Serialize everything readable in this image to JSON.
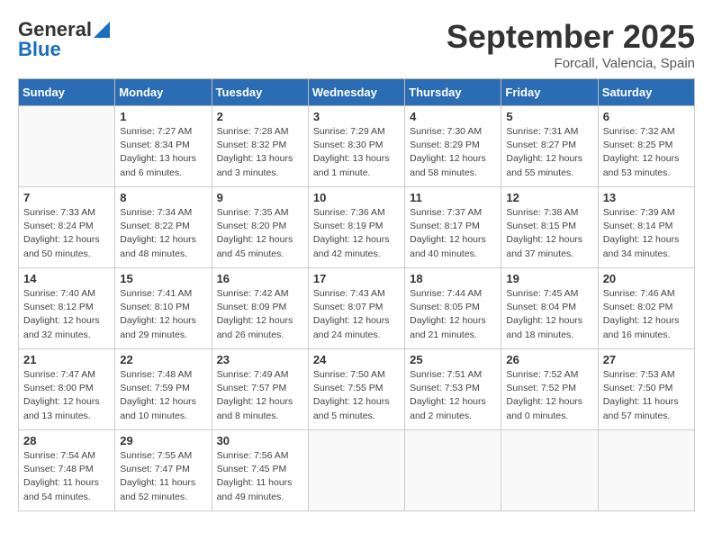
{
  "header": {
    "logo_general": "General",
    "logo_blue": "Blue",
    "month": "September 2025",
    "location": "Forcall, Valencia, Spain"
  },
  "days_of_week": [
    "Sunday",
    "Monday",
    "Tuesday",
    "Wednesday",
    "Thursday",
    "Friday",
    "Saturday"
  ],
  "weeks": [
    [
      {
        "day": "",
        "info": ""
      },
      {
        "day": "1",
        "info": "Sunrise: 7:27 AM\nSunset: 8:34 PM\nDaylight: 13 hours\nand 6 minutes."
      },
      {
        "day": "2",
        "info": "Sunrise: 7:28 AM\nSunset: 8:32 PM\nDaylight: 13 hours\nand 3 minutes."
      },
      {
        "day": "3",
        "info": "Sunrise: 7:29 AM\nSunset: 8:30 PM\nDaylight: 13 hours\nand 1 minute."
      },
      {
        "day": "4",
        "info": "Sunrise: 7:30 AM\nSunset: 8:29 PM\nDaylight: 12 hours\nand 58 minutes."
      },
      {
        "day": "5",
        "info": "Sunrise: 7:31 AM\nSunset: 8:27 PM\nDaylight: 12 hours\nand 55 minutes."
      },
      {
        "day": "6",
        "info": "Sunrise: 7:32 AM\nSunset: 8:25 PM\nDaylight: 12 hours\nand 53 minutes."
      }
    ],
    [
      {
        "day": "7",
        "info": "Sunrise: 7:33 AM\nSunset: 8:24 PM\nDaylight: 12 hours\nand 50 minutes."
      },
      {
        "day": "8",
        "info": "Sunrise: 7:34 AM\nSunset: 8:22 PM\nDaylight: 12 hours\nand 48 minutes."
      },
      {
        "day": "9",
        "info": "Sunrise: 7:35 AM\nSunset: 8:20 PM\nDaylight: 12 hours\nand 45 minutes."
      },
      {
        "day": "10",
        "info": "Sunrise: 7:36 AM\nSunset: 8:19 PM\nDaylight: 12 hours\nand 42 minutes."
      },
      {
        "day": "11",
        "info": "Sunrise: 7:37 AM\nSunset: 8:17 PM\nDaylight: 12 hours\nand 40 minutes."
      },
      {
        "day": "12",
        "info": "Sunrise: 7:38 AM\nSunset: 8:15 PM\nDaylight: 12 hours\nand 37 minutes."
      },
      {
        "day": "13",
        "info": "Sunrise: 7:39 AM\nSunset: 8:14 PM\nDaylight: 12 hours\nand 34 minutes."
      }
    ],
    [
      {
        "day": "14",
        "info": "Sunrise: 7:40 AM\nSunset: 8:12 PM\nDaylight: 12 hours\nand 32 minutes."
      },
      {
        "day": "15",
        "info": "Sunrise: 7:41 AM\nSunset: 8:10 PM\nDaylight: 12 hours\nand 29 minutes."
      },
      {
        "day": "16",
        "info": "Sunrise: 7:42 AM\nSunset: 8:09 PM\nDaylight: 12 hours\nand 26 minutes."
      },
      {
        "day": "17",
        "info": "Sunrise: 7:43 AM\nSunset: 8:07 PM\nDaylight: 12 hours\nand 24 minutes."
      },
      {
        "day": "18",
        "info": "Sunrise: 7:44 AM\nSunset: 8:05 PM\nDaylight: 12 hours\nand 21 minutes."
      },
      {
        "day": "19",
        "info": "Sunrise: 7:45 AM\nSunset: 8:04 PM\nDaylight: 12 hours\nand 18 minutes."
      },
      {
        "day": "20",
        "info": "Sunrise: 7:46 AM\nSunset: 8:02 PM\nDaylight: 12 hours\nand 16 minutes."
      }
    ],
    [
      {
        "day": "21",
        "info": "Sunrise: 7:47 AM\nSunset: 8:00 PM\nDaylight: 12 hours\nand 13 minutes."
      },
      {
        "day": "22",
        "info": "Sunrise: 7:48 AM\nSunset: 7:59 PM\nDaylight: 12 hours\nand 10 minutes."
      },
      {
        "day": "23",
        "info": "Sunrise: 7:49 AM\nSunset: 7:57 PM\nDaylight: 12 hours\nand 8 minutes."
      },
      {
        "day": "24",
        "info": "Sunrise: 7:50 AM\nSunset: 7:55 PM\nDaylight: 12 hours\nand 5 minutes."
      },
      {
        "day": "25",
        "info": "Sunrise: 7:51 AM\nSunset: 7:53 PM\nDaylight: 12 hours\nand 2 minutes."
      },
      {
        "day": "26",
        "info": "Sunrise: 7:52 AM\nSunset: 7:52 PM\nDaylight: 12 hours\nand 0 minutes."
      },
      {
        "day": "27",
        "info": "Sunrise: 7:53 AM\nSunset: 7:50 PM\nDaylight: 11 hours\nand 57 minutes."
      }
    ],
    [
      {
        "day": "28",
        "info": "Sunrise: 7:54 AM\nSunset: 7:48 PM\nDaylight: 11 hours\nand 54 minutes."
      },
      {
        "day": "29",
        "info": "Sunrise: 7:55 AM\nSunset: 7:47 PM\nDaylight: 11 hours\nand 52 minutes."
      },
      {
        "day": "30",
        "info": "Sunrise: 7:56 AM\nSunset: 7:45 PM\nDaylight: 11 hours\nand 49 minutes."
      },
      {
        "day": "",
        "info": ""
      },
      {
        "day": "",
        "info": ""
      },
      {
        "day": "",
        "info": ""
      },
      {
        "day": "",
        "info": ""
      }
    ]
  ]
}
